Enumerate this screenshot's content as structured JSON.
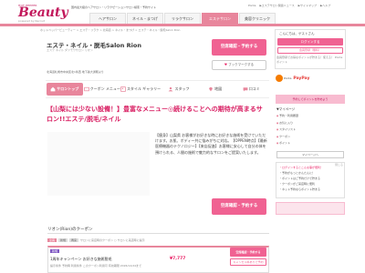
{
  "header": {
    "logo_small": "HOT PEPPER",
    "logo": "Beauty",
    "logo_sub": "powered by Recruit",
    "description": "国内最大級のヘアサロン・リラクゼーションサロン検索・予約サイト",
    "links": [
      "Ponta",
      "▶エステサロン関連ニュース",
      "▶サイトマップ",
      "▶ヘルプ"
    ],
    "tabs": [
      "ヘアサロン",
      "ネイル・まつげ",
      "リラクサロン",
      "エステサロン",
      "美容クリニック"
    ],
    "active_tab_index": 3,
    "accent_color": "#e8869c"
  },
  "breadcrumb": "ホットペッパービューティー > エステ・リラク > 北海道 > ネイル・まつげ > エステ・ネイル・脱毛Salon Rion",
  "salon": {
    "name": "エステ・ネイル・脱毛Salon Rion",
    "kana": "エステ ネイル ダツモウサロン リオン",
    "access": "北海道札幌市中央区北1条西 地下鉄大通駅より"
  },
  "buttons": {
    "reserve_top": "空席確認・予約する",
    "favorite": "ブックマークする",
    "reserve_mid": "空席確認・予約する"
  },
  "nav": [
    {
      "label": "サロントップ",
      "icon": "home-icon"
    },
    {
      "label": "クーポン メニュー",
      "icon": "coupon-icon"
    },
    {
      "label": "スタイル ギャラリー",
      "icon": "gallery-icon"
    },
    {
      "label": "スタッフ",
      "icon": "staff-icon"
    },
    {
      "label": "地図",
      "icon": "map-icon"
    },
    {
      "label": "口コミ",
      "icon": "review-icon"
    }
  ],
  "catch_copy": "【山梨には少ない設備！】豊富なメニュー◎続けることへの期待が高まるサロン!!エステ/脱毛/ネイル",
  "description": "【痩身】山梨県 お客様がお好きな時にお好きな施術を受けていただけます。お肌、ボディー共に悩みがちに対応。【OPPEN時点】【最新医療機器のテクノロジー】【来店促進】お客様に安心して自分の体を預けられる、人間の施術で魅力的なサロンをご提案いたします。",
  "coupon": {
    "heading": "リオン(Rion)のクーポン",
    "filters": [
      "全員",
      "新規",
      "再来"
    ],
    "filter_text": "サロンに来店時のクーポン  ○  サロンに来店時に提示",
    "tag": "新規",
    "title": "1周年キャンペーン お好きな施術脱毛",
    "price": "¥7,777",
    "conditions": "提示条件 予約時 利用条件 このクーポン利用可 有効期限 2026/12/24まで",
    "button_primary": "空席確認・予約する",
    "button_secondary": "キャンセル料ありで予約"
  },
  "sidebar": {
    "greeting": "こんにちは、ゲストさん",
    "login": "ログインする",
    "register": "会員登録（無料）",
    "point_note": "会員登録でお得なポイントが貯まる！使える！ Pontaポイント",
    "ponta_label": "Ponta",
    "paypay_label": "PayPay",
    "banner": "予約してポイントを貯めよう",
    "mypage_title": "▼マイページ",
    "mypage_items": [
      "予約・利用履歴",
      "お気に入り",
      "スタイリスト",
      "クーポン",
      "ポイント"
    ],
    "mypage_button": "マイページへ",
    "note_lines": [
      "・ログインするとこんな事が便利！",
      "・予約がもっとかんたんに！",
      "・ポイントはご予約だけで貯まる",
      "・クーポンがご来店時に便利",
      "・ネット予約ならポイント貯まる"
    ],
    "close_label": "閉じる"
  }
}
